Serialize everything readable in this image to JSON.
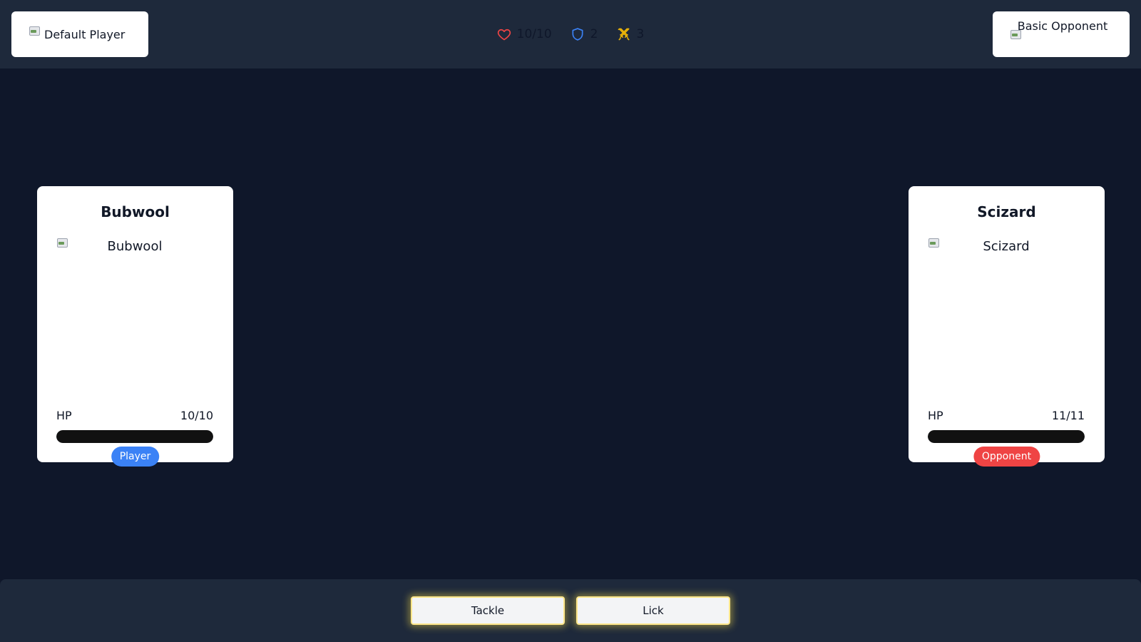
{
  "header": {
    "player_name": "Default Player",
    "opponent_name": "Basic Opponent",
    "stats": {
      "health": "10/10",
      "defense": "2",
      "attack": "3"
    }
  },
  "player_card": {
    "name": "Bubwool",
    "image_alt": "Bubwool",
    "hp_label": "HP",
    "hp_value": "10/10",
    "hp_fraction": 1.0,
    "badge": "Player"
  },
  "opponent_card": {
    "name": "Scizard",
    "image_alt": "Scizard",
    "hp_label": "HP",
    "hp_value": "11/11",
    "hp_fraction": 1.0,
    "badge": "Opponent"
  },
  "moves": [
    "Tackle",
    "Lick"
  ],
  "colors": {
    "heart": "#ef4444",
    "shield": "#3b82f6",
    "swords": "#eab308",
    "player_badge": "#3b82f6",
    "opponent_badge": "#ef4444"
  }
}
